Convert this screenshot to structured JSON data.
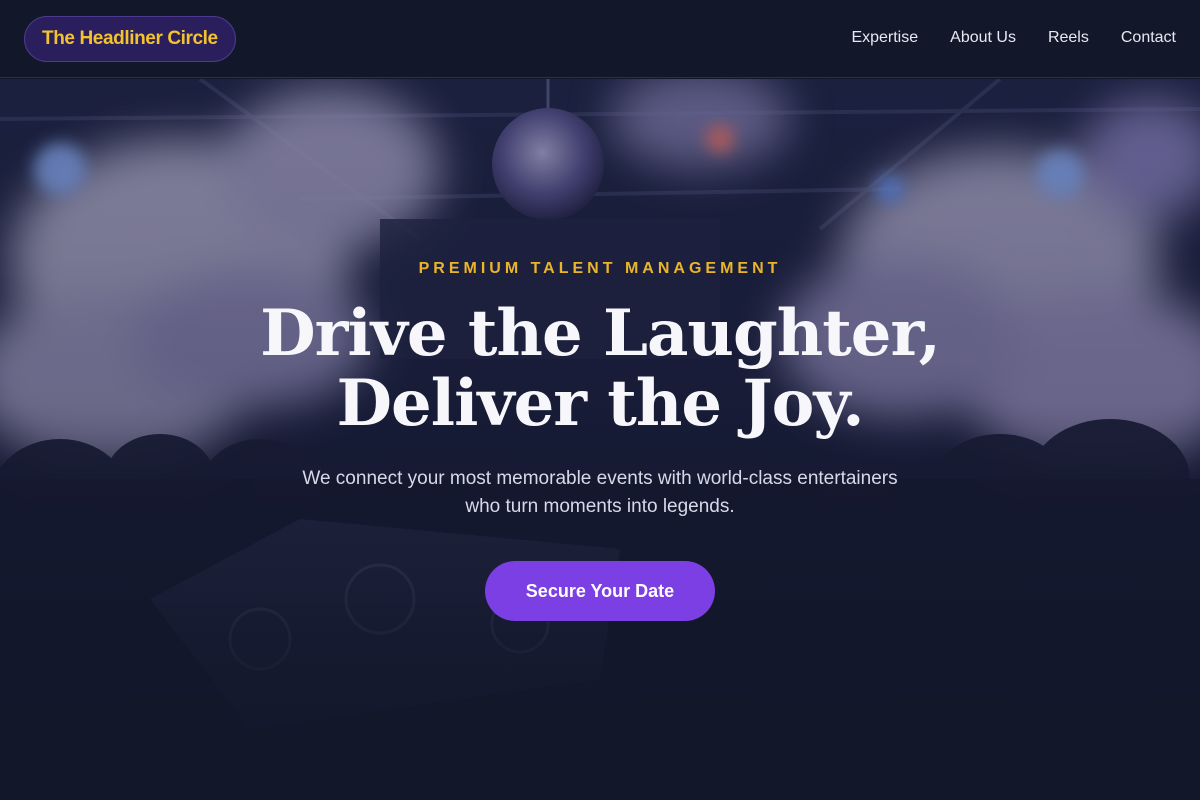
{
  "brand": {
    "name": "The Headliner Circle",
    "accent_color": "#f2c230"
  },
  "nav": {
    "items": [
      {
        "label": "Expertise"
      },
      {
        "label": "About Us"
      },
      {
        "label": "Reels"
      },
      {
        "label": "Contact"
      }
    ]
  },
  "hero": {
    "eyebrow": "PREMIUM TALENT MANAGEMENT",
    "headline_line1": "Drive the Laughter,",
    "headline_line2": "Deliver the Joy.",
    "subtext": "We connect your most memorable events with world-class entertainers who turn moments into legends.",
    "cta_label": "Secure Your Date",
    "cta_color": "#7b3fe4",
    "background": "concert-crowd-photo"
  }
}
